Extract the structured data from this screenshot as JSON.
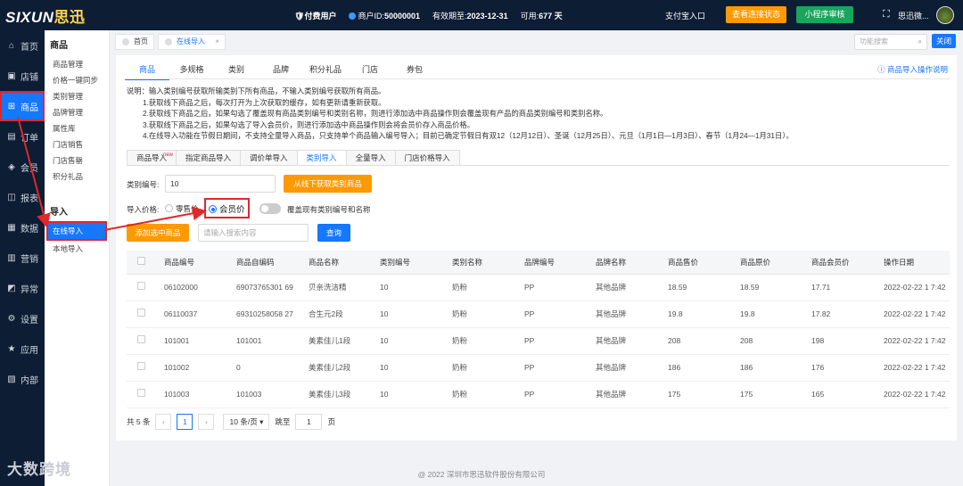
{
  "top": {
    "logo_text": "SIXUN",
    "logo_cn": "思迅",
    "paid_user": "付费用户",
    "merchant_label": "商户ID:",
    "merchant_id": "50000001",
    "expire_label": "有效期至:",
    "expire_date": "2023-12-31",
    "avail_label": "可用:",
    "avail_days": "677 天",
    "alipay": "支付宝入口",
    "connect_btn": "查看连接状态",
    "mini_btn": "小程序审核",
    "user_name": "思迅微..."
  },
  "sidebar": {
    "items": [
      {
        "icon": "⌂",
        "label": "首页"
      },
      {
        "icon": "▣",
        "label": "店铺"
      },
      {
        "icon": "⊞",
        "label": "商品"
      },
      {
        "icon": "▤",
        "label": "订单"
      },
      {
        "icon": "◈",
        "label": "会员"
      },
      {
        "icon": "◫",
        "label": "报表"
      },
      {
        "icon": "▦",
        "label": "数据"
      },
      {
        "icon": "▥",
        "label": "营销"
      },
      {
        "icon": "◩",
        "label": "异常"
      },
      {
        "icon": "⚙",
        "label": "设置"
      },
      {
        "icon": "★",
        "label": "应用"
      },
      {
        "icon": "▧",
        "label": "内部"
      }
    ]
  },
  "submenu": {
    "title1": "商品",
    "items1": [
      "商品管理",
      "价格一键同步",
      "类别管理",
      "品牌管理",
      "属性库",
      "门店销售",
      "门店售罄",
      "积分礼品"
    ],
    "title2": "导入",
    "items2": [
      "在线导入",
      "本地导入"
    ]
  },
  "tabs": {
    "home": "首页",
    "current": "在线导入",
    "close_x": "×",
    "search_placeholder": "功能搜索",
    "close_btn": "关闭"
  },
  "nav": {
    "items": [
      "商品",
      "多规格",
      "类别",
      "品牌",
      "积分礼品",
      "门店",
      "券包"
    ],
    "help": "商品导入操作说明"
  },
  "desc": {
    "lines": [
      "说明：输入类别编号获取所输类别下所有商品，不输入类别编号获取所有商品。",
      "1.获取线下商品之后，每次打开为上次获取的缓存，如有更新请重新获取。",
      "2.获取线下商品之后，如果勾选了覆盖现有商品类别编号和类别名称，则进行添加选中商品操作则会覆盖现有产品的商品类别编号和类别名称。",
      "3.获取线下商品之后，如果勾选了导入会员价，则进行添加选中商品操作则会将会员价存入商品价格。",
      "4.在线导入功能在节假日期间，不支持全量导入商品，只支持单个商品输入编号导入；目前已确定节假日有双12（12月12日）、圣诞（12月25日）、元旦（1月1日—1月3日）、春节（1月24—1月31日）。"
    ]
  },
  "subtabs": {
    "items": [
      "商品导入",
      "指定商品导入",
      "调价单导入",
      "类别导入",
      "全量导入",
      "门店价格导入"
    ],
    "new_badge": "new"
  },
  "form": {
    "cat_label": "类别编号:",
    "cat_value": "10",
    "fetch_btn": "从线下获取类别商品",
    "price_label": "导入价格:",
    "retail": "零售价",
    "member": "会员价",
    "overwrite": "覆盖现有类别编号和名称",
    "add_btn": "添加选中商品",
    "search_placeholder": "请输入搜索内容",
    "query_btn": "查询"
  },
  "table": {
    "headers": [
      "商品编号",
      "商品自编码",
      "商品名称",
      "类别编号",
      "类别名称",
      "品牌编号",
      "品牌名称",
      "商品售价",
      "商品原价",
      "商品会员价",
      "操作日期"
    ],
    "rows": [
      [
        "06102000",
        "69073765301 69",
        "贝亲洗洁精",
        "10",
        "奶粉",
        "PP",
        "其他品牌",
        "18.59",
        "18.59",
        "17.71",
        "2022-02-22 1 7:42"
      ],
      [
        "06110037",
        "69310258058 27",
        "合生元2段",
        "10",
        "奶粉",
        "PP",
        "其他品牌",
        "19.8",
        "19.8",
        "17.82",
        "2022-02-22 1 7:42"
      ],
      [
        "101001",
        "101001",
        "美素佳儿1段",
        "10",
        "奶粉",
        "PP",
        "其他品牌",
        "208",
        "208",
        "198",
        "2022-02-22 1 7:42"
      ],
      [
        "101002",
        "0",
        "美素佳儿2段",
        "10",
        "奶粉",
        "PP",
        "其他品牌",
        "186",
        "186",
        "176",
        "2022-02-22 1 7:42"
      ],
      [
        "101003",
        "101003",
        "美素佳儿3段",
        "10",
        "奶粉",
        "PP",
        "其他品牌",
        "175",
        "175",
        "165",
        "2022-02-22 1 7:42"
      ]
    ]
  },
  "pager": {
    "total": "共 5 条",
    "prev": "‹",
    "page": "1",
    "next": "›",
    "size": "10 条/页",
    "jump": "跳至",
    "jump_val": "1",
    "unit": "页"
  },
  "footer": "@ 2022 深圳市思迅软件股份有限公司",
  "watermark": "大数跨境"
}
